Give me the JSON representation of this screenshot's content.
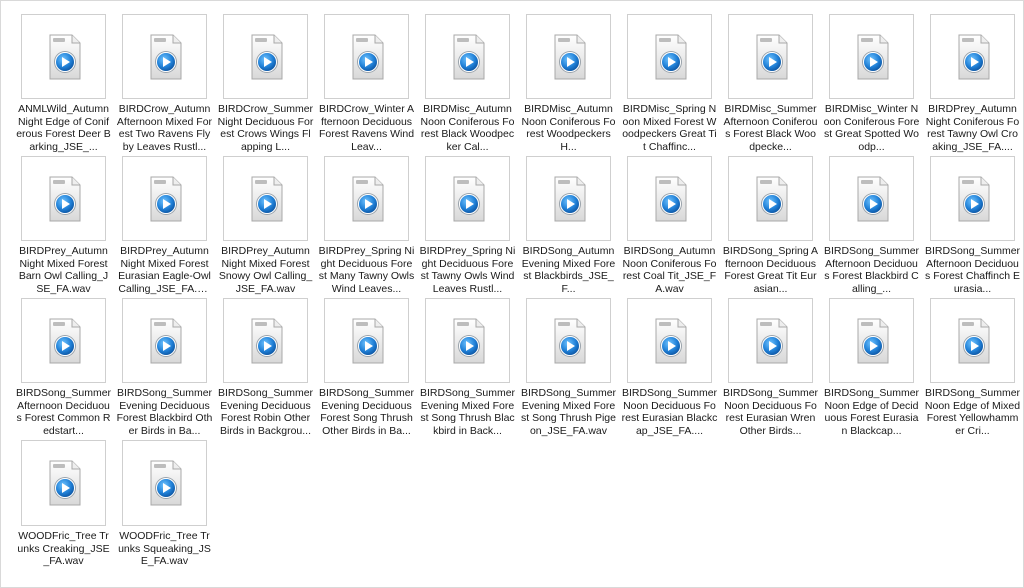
{
  "icon": {
    "name": "wav-media-file-icon",
    "accent": "#1f7fd6"
  },
  "files": [
    {
      "name": "ANMLWild_Autumn Night Edge of Coniferous Forest Deer Barking_JSE_..."
    },
    {
      "name": "BIRDCrow_Autumn Afternoon Mixed Forest Two Ravens Flyby Leaves Rustl..."
    },
    {
      "name": "BIRDCrow_Summer Night Deciduous Forest Crows Wings Flapping L..."
    },
    {
      "name": "BIRDCrow_Winter Afternoon Deciduous Forest Ravens Wind Leav..."
    },
    {
      "name": "BIRDMisc_Autumn Noon Coniferous Forest Black Woodpecker Cal..."
    },
    {
      "name": "BIRDMisc_Autumn Noon Coniferous Forest Woodpeckers H..."
    },
    {
      "name": "BIRDMisc_Spring Noon Mixed Forest Woodpeckers Great Tit Chaffinc..."
    },
    {
      "name": "BIRDMisc_Summer Afternoon Coniferous Forest Black Woodpecke..."
    },
    {
      "name": "BIRDMisc_Winter Noon Coniferous Forest Great Spotted Woodp..."
    },
    {
      "name": "BIRDPrey_Autumn Night Coniferous Forest Tawny Owl Croaking_JSE_FA...."
    },
    {
      "name": "BIRDPrey_Autumn Night Mixed Forest Barn Owl Calling_JSE_FA.wav"
    },
    {
      "name": "BIRDPrey_Autumn Night Mixed Forest Eurasian Eagle-Owl Calling_JSE_FA.wav"
    },
    {
      "name": "BIRDPrey_Autumn Night Mixed Forest Snowy Owl Calling_JSE_FA.wav"
    },
    {
      "name": "BIRDPrey_Spring Night Deciduous Forest Many Tawny Owls Wind Leaves..."
    },
    {
      "name": "BIRDPrey_Spring Night Deciduous Forest Tawny Owls Wind Leaves Rustl..."
    },
    {
      "name": "BIRDSong_Autumn Evening Mixed Forest Blackbirds_JSE_F..."
    },
    {
      "name": "BIRDSong_Autumn Noon Coniferous Forest Coal Tit_JSE_FA.wav"
    },
    {
      "name": "BIRDSong_Spring Afternoon Deciduous Forest Great Tit Eurasian..."
    },
    {
      "name": "BIRDSong_Summer Afternoon Deciduous Forest Blackbird Calling_..."
    },
    {
      "name": "BIRDSong_Summer Afternoon Deciduous Forest Chaffinch Eurasia..."
    },
    {
      "name": "BIRDSong_Summer Afternoon Deciduous Forest Common Redstart..."
    },
    {
      "name": "BIRDSong_Summer Evening Deciduous Forest Blackbird Other Birds in Ba..."
    },
    {
      "name": "BIRDSong_Summer Evening Deciduous Forest Robin Other Birds in Backgrou..."
    },
    {
      "name": "BIRDSong_Summer Evening Deciduous Forest Song Thrush Other Birds in Ba..."
    },
    {
      "name": "BIRDSong_Summer Evening Mixed Forest Song Thrush Blackbird in Back..."
    },
    {
      "name": "BIRDSong_Summer Evening Mixed Forest Song Thrush Pigeon_JSE_FA.wav"
    },
    {
      "name": "BIRDSong_Summer Noon Deciduous Forest Eurasian Blackcap_JSE_FA...."
    },
    {
      "name": "BIRDSong_Summer Noon Deciduous Forest Eurasian Wren Other Birds..."
    },
    {
      "name": "BIRDSong_Summer Noon Edge of Deciduous Forest Eurasian Blackcap..."
    },
    {
      "name": "BIRDSong_Summer Noon Edge of Mixed Forest Yellowhammer Cri..."
    },
    {
      "name": "WOODFric_Tree Trunks Creaking_JSE_FA.wav"
    },
    {
      "name": "WOODFric_Tree Trunks Squeaking_JSE_FA.wav"
    }
  ]
}
